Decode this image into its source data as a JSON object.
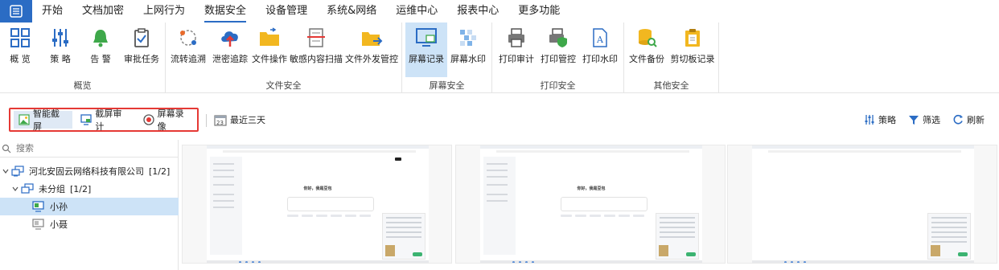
{
  "menu": {
    "app_icon": "grid-menu-icon",
    "items": [
      "开始",
      "文档加密",
      "上网行为",
      "数据安全",
      "设备管理",
      "系统&网络",
      "运维中心",
      "报表中心",
      "更多功能"
    ],
    "active_index": 3
  },
  "ribbon": {
    "groups": [
      {
        "title": "概览",
        "buttons": [
          "概 览",
          "策 略",
          "告 警",
          "审批任务"
        ]
      },
      {
        "title": "文件安全",
        "buttons": [
          "流转追溯",
          "泄密追踪",
          "文件操作",
          "敏感内容扫描",
          "文件外发管控"
        ]
      },
      {
        "title": "屏幕安全",
        "buttons": [
          "屏幕记录",
          "屏幕水印"
        ]
      },
      {
        "title": "打印安全",
        "buttons": [
          "打印审计",
          "打印管控",
          "打印水印"
        ]
      },
      {
        "title": "其他安全",
        "buttons": [
          "文件备份",
          "剪切板记录"
        ]
      }
    ],
    "active_button": "屏幕记录"
  },
  "toolbar": {
    "tabs": [
      "智能截屏",
      "截屏审计",
      "屏幕录像"
    ],
    "active_tab": "智能截屏",
    "date_filter": "最近三天",
    "right_buttons": [
      "策略",
      "筛选",
      "刷新"
    ]
  },
  "sidebar": {
    "search_placeholder": "搜索",
    "tree": [
      {
        "label": "河北安固云网络科技有限公司",
        "count": "[1/2]"
      },
      {
        "label": "未分组",
        "count": "[1/2]"
      },
      {
        "label": "小孙",
        "count": ""
      },
      {
        "label": "小聂",
        "count": ""
      }
    ],
    "selected": "小孙"
  },
  "screenshots": {
    "count": 3,
    "greeting_text": "你好，我是豆包"
  },
  "colors": {
    "brand_blue": "#2b6cc4",
    "active_bg": "#cde3f7",
    "highlight_border": "#e53935"
  }
}
